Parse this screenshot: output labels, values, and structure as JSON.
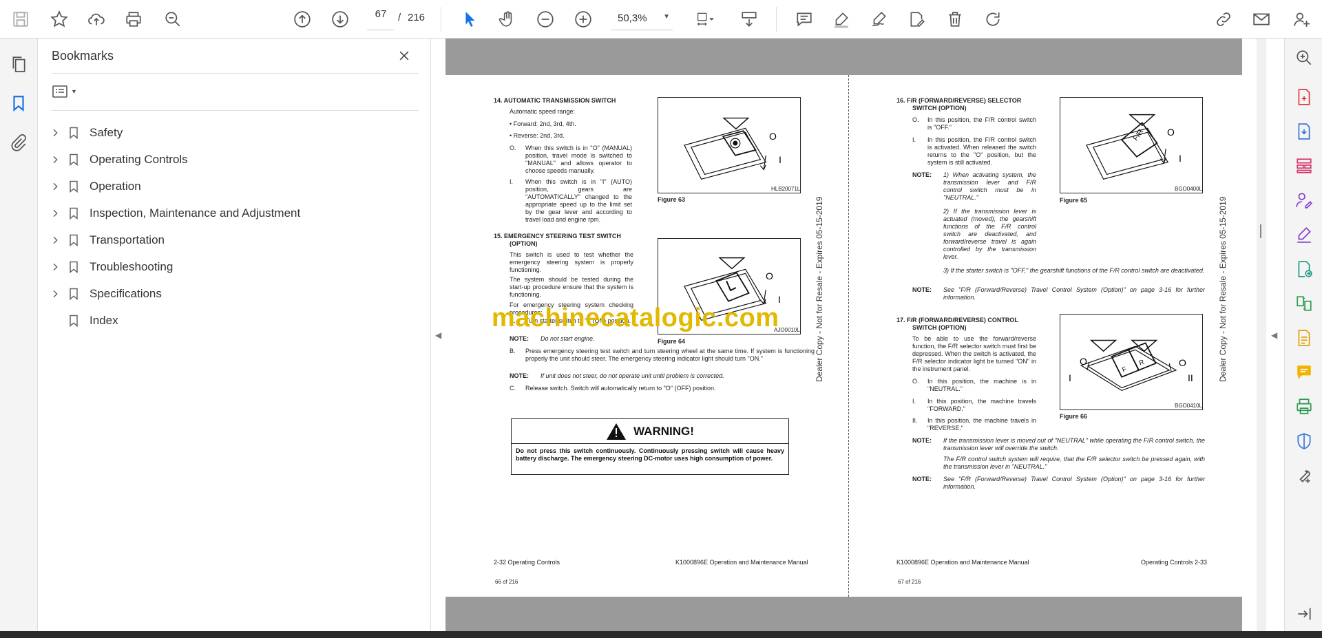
{
  "toolbar": {
    "page_current": "67",
    "page_separator": "/",
    "page_total": "216",
    "zoom": "50,3%"
  },
  "left_rail": {
    "icons": [
      "pages-icon",
      "bookmark-icon",
      "attachment-icon"
    ]
  },
  "bookmarks_panel": {
    "title": "Bookmarks",
    "items": [
      {
        "label": "Safety",
        "expandable": true
      },
      {
        "label": "Operating Controls",
        "expandable": true
      },
      {
        "label": "Operation",
        "expandable": true
      },
      {
        "label": "Inspection, Maintenance and Adjustment",
        "expandable": true
      },
      {
        "label": "Transportation",
        "expandable": true
      },
      {
        "label": "Troubleshooting",
        "expandable": true
      },
      {
        "label": "Specifications",
        "expandable": true
      },
      {
        "label": "Index",
        "expandable": false
      }
    ]
  },
  "document": {
    "watermark": "machinecatalogic.com",
    "side_stamp": "Dealer Copy - Not for Resale - Expires 05-15-2019",
    "left_page": {
      "s14_title": "14.   AUTOMATIC TRANSMISSION SWITCH",
      "s14_intro": "Automatic speed range:",
      "s14_b1": "•     Forward: 2nd, 3rd, 4th.",
      "s14_b2": "•     Reverse: 2nd, 3rd.",
      "s14_o": "When this switch is in \"O\" (MANUAL) position, travel mode is switched to \"MANUAL\" and allows operator to choose speeds manually.",
      "s14_i": "When this switch is in \"I\" (AUTO) position, gears are \"AUTOMATICALLY\" changed to the appropriate speed up to the limit set by the gear lever and according to travel load and engine rpm.",
      "fig63_caption": "Figure 63",
      "fig63_code": "HLB20071L",
      "s15_title": "15.   EMERGENCY STEERING TEST SWITCH",
      "s15_title2": "(OPTION)",
      "s15_p1": "This switch is used to test whether the emergency steering system is properly functioning.",
      "s15_p2": "The system should be tested during the start-up procedure ensure that the system is functioning.",
      "s15_p3": "For emergency steering system checking procedures:",
      "s15_a": "Turn starter switch to \"I\" (ON) position.",
      "s15_note1": "Do not start engine.",
      "s15_b": "Press emergency steering test switch and turn steering wheel at the same time. If system is functioning properly the unit should steer. The emergency steering indicator light should turn \"ON.\"",
      "s15_note2": "If unit does not steer, do not operate unit until problem is corrected.",
      "s15_c": "Release switch. Switch will automatically return to \"O\" (OFF) position.",
      "fig64_caption": "Figure 64",
      "fig64_code": "AJO0010L",
      "warning_title": "WARNING!",
      "warning_text": "Do not press this switch continuously. Continuously pressing switch will cause heavy battery discharge. The emergency steering DC-motor uses high consumption of power.",
      "footer_left": "2-32  Operating Controls",
      "footer_right": "K1000896E Operation and Maintenance Manual",
      "page_of": "66 of 216"
    },
    "right_page": {
      "s16_title": "16.   F/R (FORWARD/REVERSE) SELECTOR",
      "s16_title2": "SWITCH (OPTION)",
      "s16_o": "In this position, the F/R control switch is \"OFF.\"",
      "s16_i": "In this position, the F/R control switch is activated. When released the switch returns to the \"O\" position, but the system is still activated.",
      "s16_note1": "1) When activating system, the transmission lever and F/R control switch must be in \"NEUTRAL.\"",
      "s16_note2": "2) If the transmission lever is actuated (moved), the gearshift functions of the F/R control switch are deactivated, and forward/reverse travel is again controlled by the transmission lever.",
      "s16_note3": "3) If the starter switch is \"OFF,\" the gearshift functions of the F/R control switch are deactivated.",
      "s16_note4": "See \"F/R (Forward/Reverse) Travel Control System (Option)\" on page 3-16 for further information.",
      "fig65_caption": "Figure 65",
      "fig65_code": "BGO0400L",
      "s17_title": "17.   F/R (FORWARD/REVERSE) CONTROL",
      "s17_title2": "SWITCH (OPTION)",
      "s17_p1": "To be able to use the forward/reverse function, the F/R selector switch must first be depressed. When the switch is activated, the F/R selector indicator light be turned \"ON\" in the instrument panel.",
      "s17_o": "In this position, the machine is in \"NEUTRAL.\"",
      "s17_i": "In this position, the machine travels \"FORWARD.\"",
      "s17_ii": "In this position, the machine travels in \"REVERSE.\"",
      "s17_note1": "If the transmission lever is moved out of \"NEUTRAL\" while operating the F/R control switch, the transmission lever will override the switch.",
      "s17_note1b": "The F/R control switch system will require, that the F/R selector switch be pressed again, with the transmission lever in \"NEUTRAL.\"",
      "s17_note2": "See \"F/R (Forward/Reverse) Travel Control System (Option)\" on page 3-16 for further information.",
      "fig66_caption": "Figure 66",
      "fig66_code": "BGO0410L",
      "footer_left": "K1000896E Operation and Maintenance Manual",
      "footer_right": "Operating Controls 2-33",
      "page_of": "67 of 216"
    }
  },
  "colors": {
    "accent": "#1473e6",
    "watermark": "#e3b800",
    "gray_bar": "#9a9a9a"
  }
}
